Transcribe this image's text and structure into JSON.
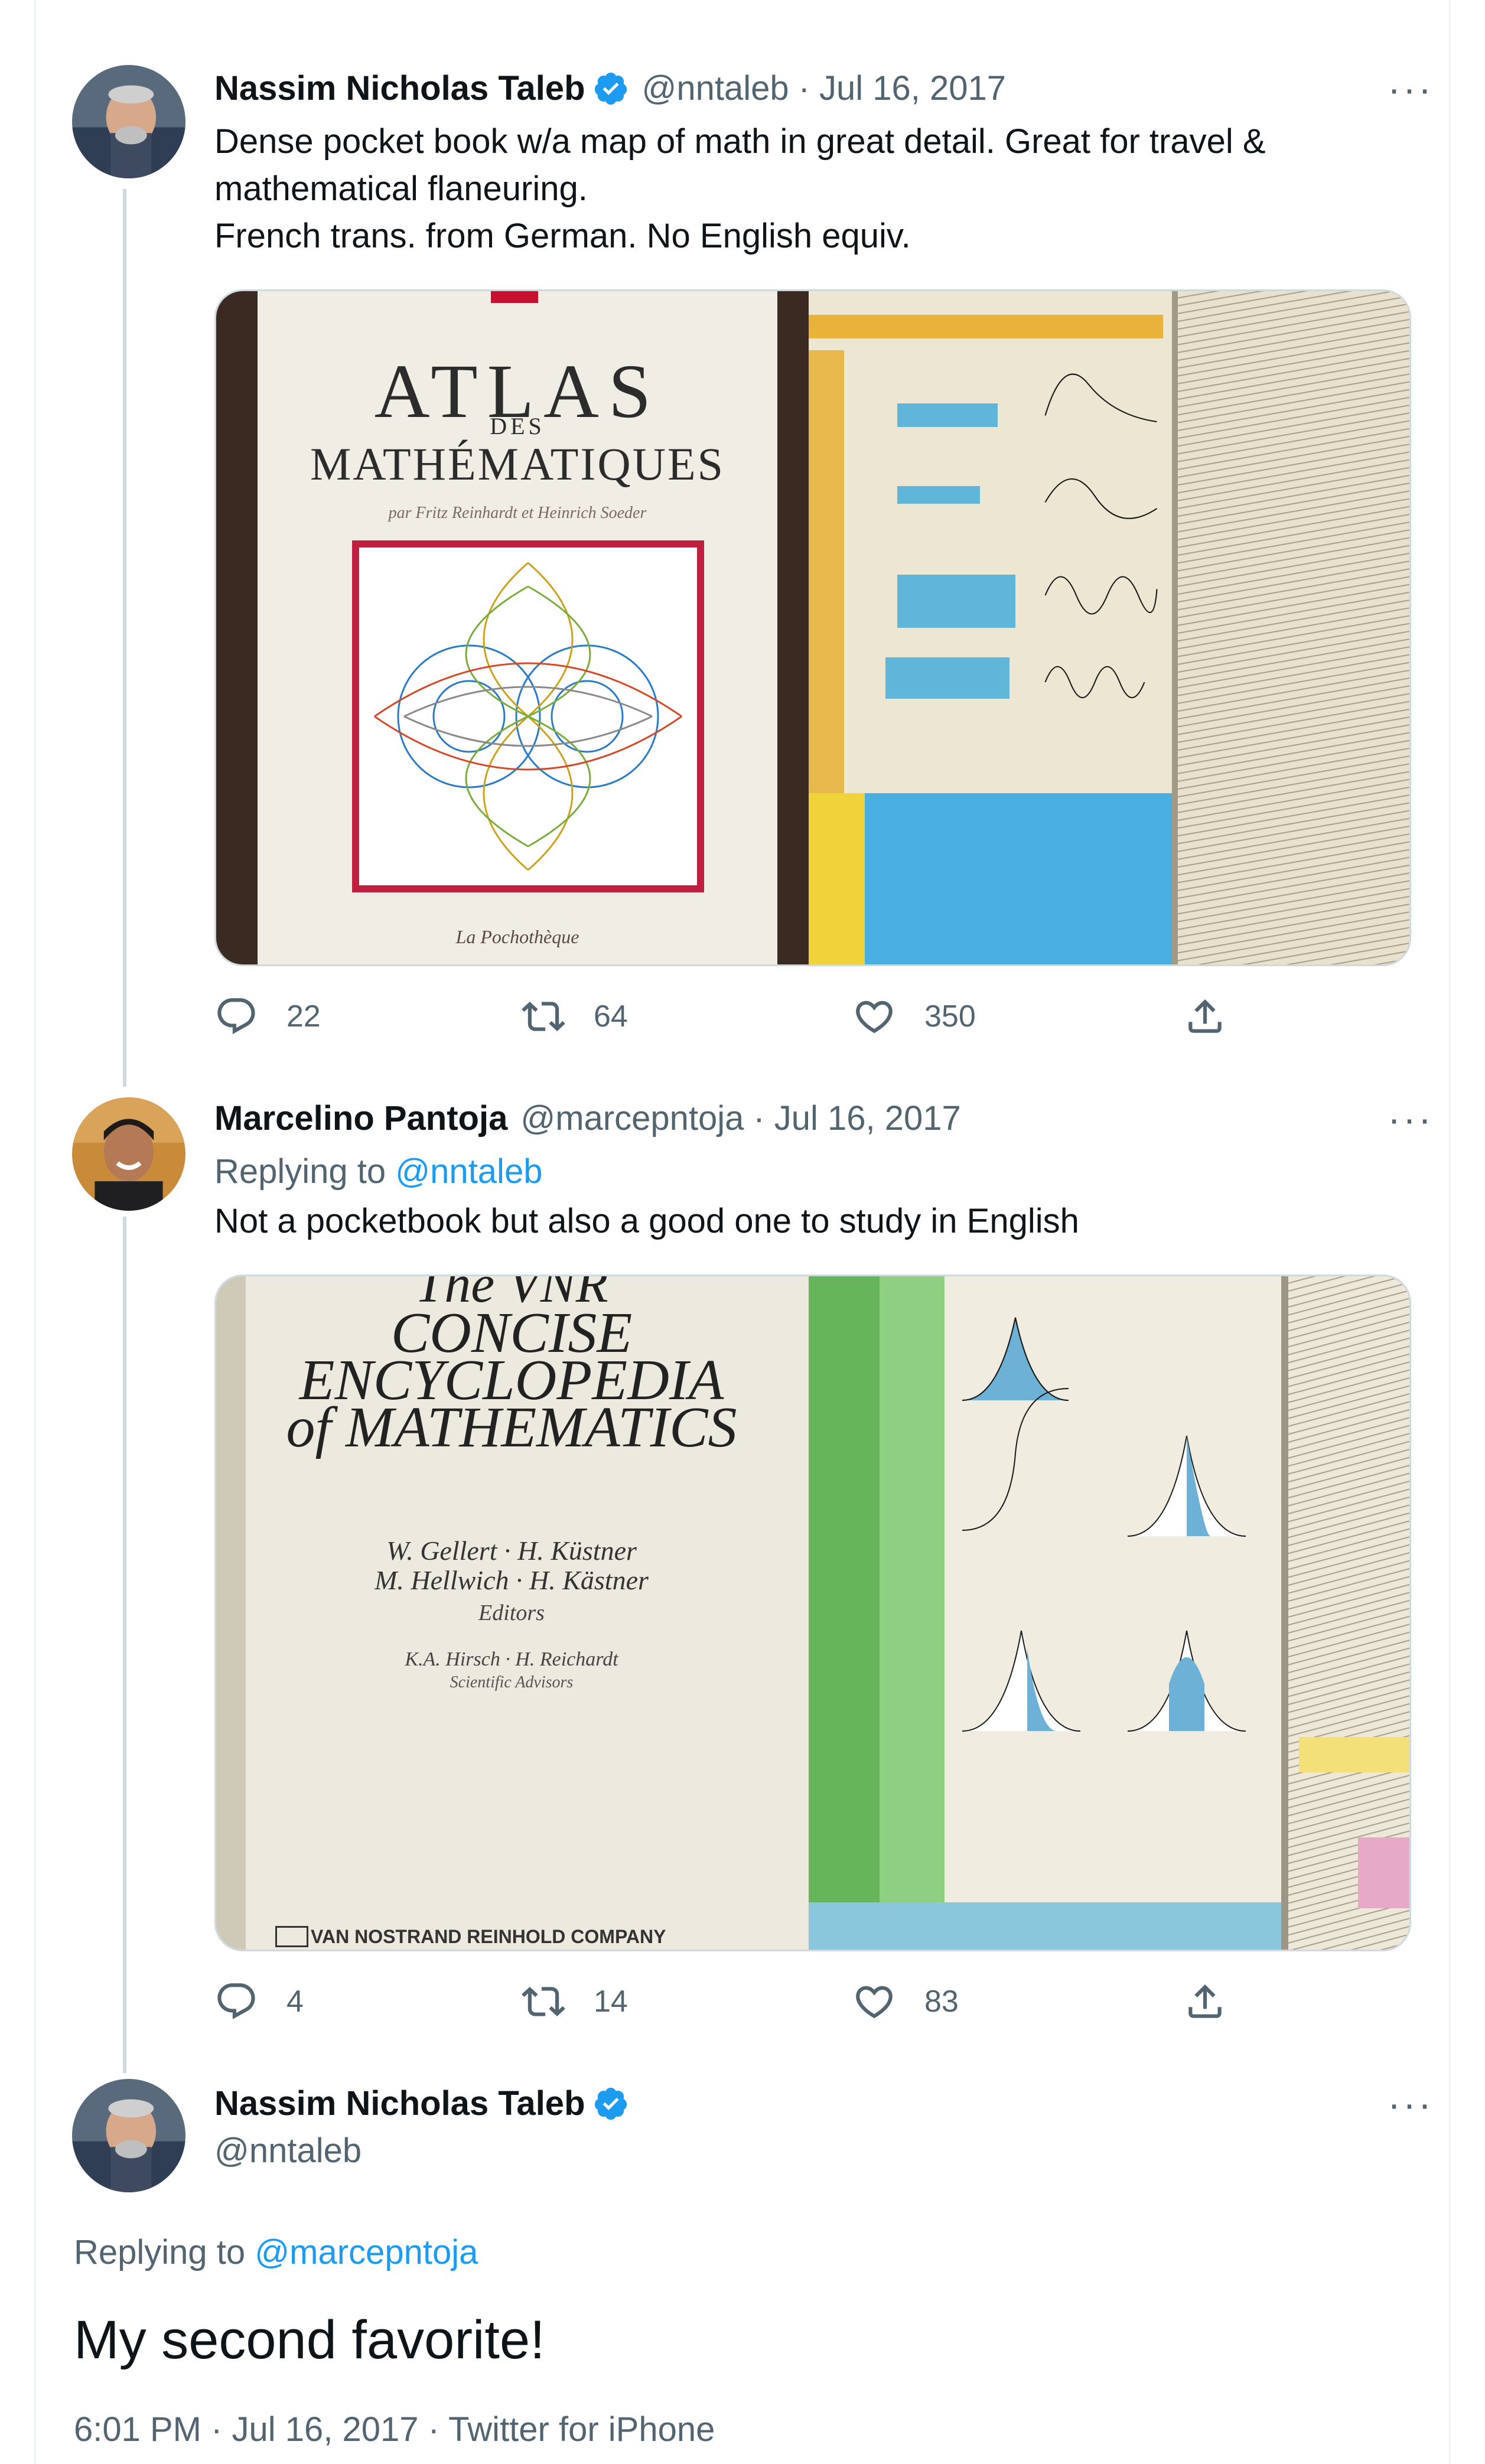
{
  "thread": [
    {
      "author": {
        "name": "Nassim Nicholas Taleb",
        "handle": "@nntaleb",
        "verified": true
      },
      "date": "Jul 16, 2017",
      "text_lines": [
        "Dense pocket book w/a map of math in great detail. Great for travel &",
        "mathematical flaneuring.",
        "French trans. from German. No English equiv."
      ],
      "media": {
        "cover": {
          "title": "ATLAS",
          "des": "DES",
          "subtitle": "MATHÉMATIQUES",
          "authors": "par Fritz Reinhardt et Heinrich Soeder",
          "publisher": "La Pochothèque"
        }
      },
      "stats": {
        "replies": "22",
        "retweets": "64",
        "likes": "350"
      }
    },
    {
      "author": {
        "name": "Marcelino Pantoja",
        "handle": "@marcepntoja",
        "verified": false
      },
      "date": "Jul 16, 2017",
      "replying_to_label": "Replying to",
      "replying_to": "@nntaleb",
      "text": "Not a pocketbook but also a good one to study in English",
      "media": {
        "cover": {
          "title_top": "The VNR",
          "title_1": "CONCISE",
          "title_2": "ENCYCLOPEDIA",
          "title_3": "of MATHEMATICS",
          "editors_1": "W. Gellert · H. Küstner",
          "editors_2": "M. Hellwich · H. Kästner",
          "editors_label": "Editors",
          "advisors": "K.A. Hirsch · H. Reichardt",
          "advisors_label": "Scientific Advisors",
          "publisher": "VAN NOSTRAND REINHOLD COMPANY"
        }
      },
      "stats": {
        "replies": "4",
        "retweets": "14",
        "likes": "83"
      }
    },
    {
      "author": {
        "name": "Nassim Nicholas Taleb",
        "handle": "@nntaleb",
        "verified": true
      },
      "replying_to_label": "Replying to",
      "replying_to": "@marcepntoja",
      "text": "My second favorite!",
      "meta": "6:01 PM · Jul 16, 2017 · Twitter for iPhone"
    }
  ],
  "ui": {
    "separator": "·",
    "more": "···"
  },
  "colors": {
    "link": "#1d9bf0",
    "verified": "#1d9bf0",
    "secondary_text": "#536471",
    "thread_line": "#cfd9de"
  },
  "icons": [
    "reply-icon",
    "retweet-icon",
    "like-icon",
    "share-icon",
    "more-icon",
    "verified-icon"
  ]
}
